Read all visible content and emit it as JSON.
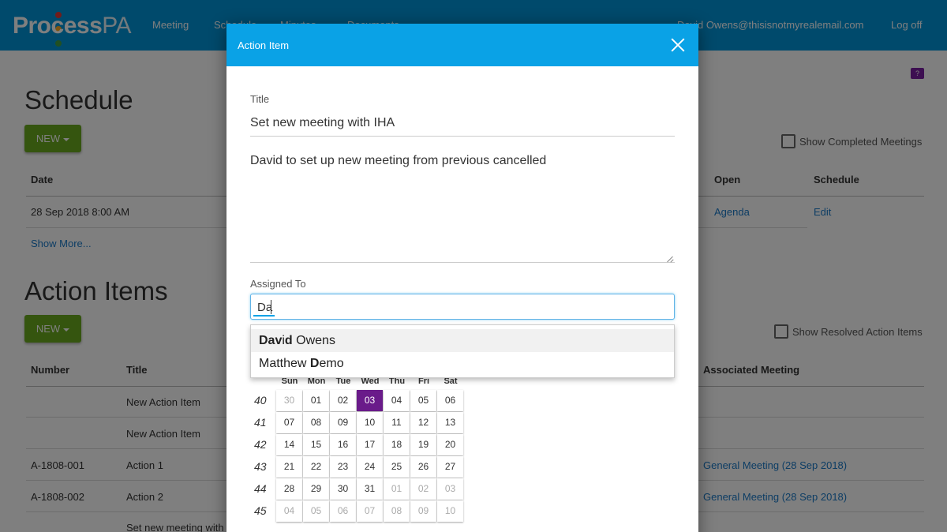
{
  "app": {
    "logo_main": "Process",
    "logo_sub": "PA",
    "logo_dot_colors": [
      "#e53935",
      "#f9a825",
      "#43a047"
    ]
  },
  "nav": {
    "links": [
      "Meeting",
      "Schedule",
      "Minutes",
      "Documents"
    ],
    "user": "David Owens@thisisnotmyrealemail.com",
    "logoff": "Log off"
  },
  "help_badge": "?",
  "schedule": {
    "title": "Schedule",
    "new_label": "NEW",
    "show_completed_label": "Show Completed Meetings",
    "columns": {
      "date": "Date",
      "open": "Open",
      "schedule": "Schedule"
    },
    "rows": [
      {
        "date": "28 Sep 2018 8:00 AM",
        "open": "Agenda",
        "schedule": "Edit"
      }
    ],
    "show_more": "Show More..."
  },
  "action_items": {
    "title": "Action Items",
    "new_label": "NEW",
    "show_resolved_label": "Show Resolved Action Items",
    "columns": {
      "number": "Number",
      "title": "Title",
      "meeting": "Associated Meeting"
    },
    "rows": [
      {
        "number": "",
        "title": "New Action Item",
        "meeting": ""
      },
      {
        "number": "",
        "title": "New Action Item",
        "meeting": ""
      },
      {
        "number": "A-1808-001",
        "title": "Action 1",
        "meeting": "General Meeting (28 Sep 2018)"
      },
      {
        "number": "A-1808-002",
        "title": "Action 2",
        "meeting": "General Meeting (28 Sep 2018)"
      },
      {
        "number": "",
        "title": "Set new meeting with",
        "meeting": ""
      }
    ]
  },
  "modal": {
    "header": "Action Item",
    "title_label": "Title",
    "title_value": "Set new meeting with IHA",
    "description_value": "David to set up new meeting from previous cancelled",
    "assigned_label": "Assigned To",
    "assigned_value": "Da",
    "suggestions": [
      {
        "match": "Dav",
        "mid": "i",
        "match2": "d",
        "rest": " Owens"
      },
      {
        "pre": "Matthew ",
        "match": "D",
        "rest": "emo"
      }
    ]
  },
  "calendar": {
    "weekdays": [
      "Sun",
      "Mon",
      "Tue",
      "Wed",
      "Thu",
      "Fri",
      "Sat"
    ],
    "weeks": [
      {
        "num": "40",
        "days": [
          "30",
          "01",
          "02",
          "03",
          "04",
          "05",
          "06"
        ]
      },
      {
        "num": "41",
        "days": [
          "07",
          "08",
          "09",
          "10",
          "11",
          "12",
          "13"
        ]
      },
      {
        "num": "42",
        "days": [
          "14",
          "15",
          "16",
          "17",
          "18",
          "19",
          "20"
        ]
      },
      {
        "num": "43",
        "days": [
          "21",
          "22",
          "23",
          "24",
          "25",
          "26",
          "27"
        ]
      },
      {
        "num": "44",
        "days": [
          "28",
          "29",
          "30",
          "31",
          "01",
          "02",
          "03"
        ]
      },
      {
        "num": "45",
        "days": [
          "04",
          "05",
          "06",
          "07",
          "08",
          "09",
          "10"
        ]
      }
    ],
    "muted": [
      [
        0,
        0
      ],
      [
        4,
        4
      ],
      [
        4,
        5
      ],
      [
        4,
        6
      ],
      [
        5,
        0
      ],
      [
        5,
        1
      ],
      [
        5,
        2
      ],
      [
        5,
        3
      ],
      [
        5,
        4
      ],
      [
        5,
        5
      ],
      [
        5,
        6
      ]
    ],
    "selected": [
      0,
      3
    ],
    "selected_color": "#6a1b8a"
  }
}
